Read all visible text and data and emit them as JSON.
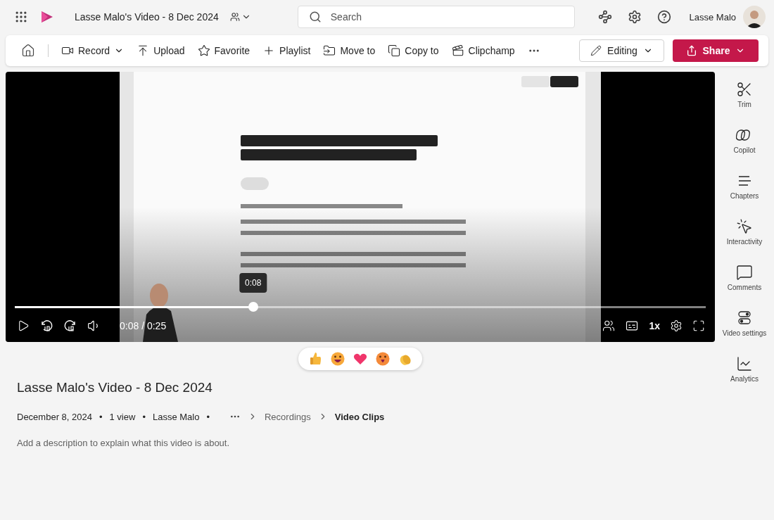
{
  "app_bar": {
    "video_title": "Lasse Malo's Video - 8 Dec 2024",
    "search": {
      "placeholder": "Search"
    },
    "user_name": "Lasse Malo"
  },
  "toolbar": {
    "items": [
      {
        "label": "Record",
        "kind": "dropdown"
      },
      {
        "label": "Upload",
        "kind": "plain"
      },
      {
        "label": "Favorite",
        "kind": "plain"
      },
      {
        "label": "Playlist",
        "kind": "plain"
      },
      {
        "label": "Move to",
        "kind": "plain"
      },
      {
        "label": "Copy to",
        "kind": "plain"
      },
      {
        "label": "Clipchamp",
        "kind": "plain"
      }
    ],
    "editing": "Editing",
    "share": "Share"
  },
  "player": {
    "tooltip": "0:08",
    "level": 0.345,
    "time": "0:08 / 0:25",
    "speed": "1x"
  },
  "side_rail": [
    {
      "label": "Trim"
    },
    {
      "label": "Copilot"
    },
    {
      "label": "Chapters"
    },
    {
      "label": "Interactivity"
    },
    {
      "label": "Comments"
    },
    {
      "label": "Video settings"
    },
    {
      "label": "Analytics"
    }
  ],
  "details": {
    "title": "Lasse Malo's Video - 8 Dec 2024",
    "meta": [
      {
        "text": "December 8, 2024",
        "separator": "•"
      },
      {
        "text": "1 view",
        "separator": "•"
      },
      {
        "text": "Lasse Malo",
        "separator": "•"
      }
    ],
    "breadcrumb": [
      {
        "label": "Recordings",
        "current": false
      },
      {
        "label": "Video Clips",
        "current": true
      }
    ],
    "description": "Add a description to explain what this video is about."
  }
}
